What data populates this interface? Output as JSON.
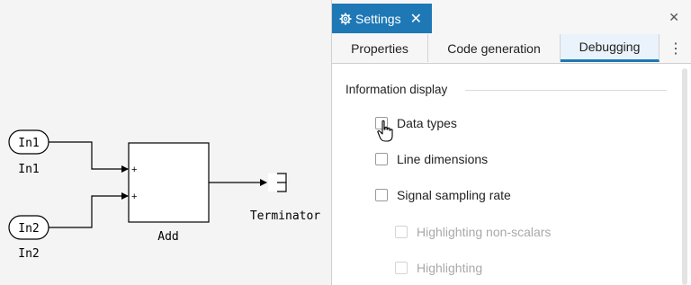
{
  "diagram": {
    "in1_block_text": "In1",
    "in1_caption": "In1",
    "in2_block_text": "In2",
    "in2_caption": "In2",
    "add_caption": "Add",
    "add_port1_sign": "+",
    "add_port2_sign": "+",
    "terminator_caption": "Terminator"
  },
  "panel": {
    "title": "Settings",
    "close_tab_glyph": "✕",
    "close_panel_glyph": "✕",
    "tabs": [
      {
        "label": "Properties"
      },
      {
        "label": "Code generation"
      },
      {
        "label": "Debugging"
      }
    ],
    "active_tab": "Debugging",
    "more_glyph": "⋮",
    "section_title": "Information display",
    "options": [
      {
        "label": "Data types",
        "checked": false,
        "enabled": true
      },
      {
        "label": "Line dimensions",
        "checked": false,
        "enabled": true
      },
      {
        "label": "Signal sampling rate",
        "checked": false,
        "enabled": true
      },
      {
        "label": "Highlighting non-scalars",
        "checked": false,
        "enabled": false
      },
      {
        "label": "Highlighting",
        "checked": false,
        "enabled": false
      }
    ]
  },
  "colors": {
    "accent": "#1e78b5",
    "canvas_bg": "#f4f4f4"
  }
}
